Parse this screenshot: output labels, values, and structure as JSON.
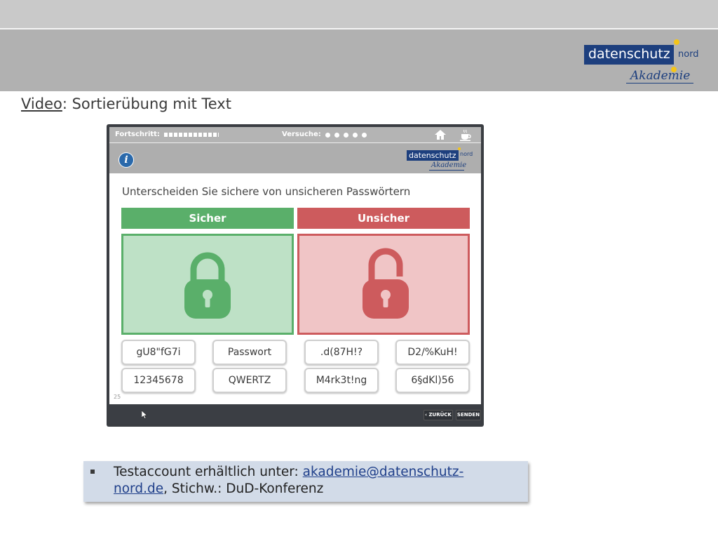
{
  "slide": {
    "title_keyword": "Video",
    "title_rest": ": Sortierübung mit Text"
  },
  "logo": {
    "brand": "datenschutz",
    "suffix": "nord",
    "subline": "Akademie"
  },
  "video": {
    "progress_label": "Fortschritt:",
    "progress_value": 1.0,
    "attempts_label": "Versuche:",
    "attempts_total": 5,
    "question": "Unterscheiden Sie sichere von unsicheren Passwörtern",
    "categories": [
      {
        "label": "Sicher",
        "color": "#5aaf6a"
      },
      {
        "label": "Unsicher",
        "color": "#cd5b5d"
      }
    ],
    "chips": [
      "gU8\"fG7i",
      "Passwort",
      ".d(87H!?",
      "D2/%KuH!",
      "12345678",
      "QWERTZ",
      "M4rk3t!ng",
      "6§dKl)56"
    ],
    "page_number": "25",
    "back_label": "‹ ZURÜCK",
    "send_label": "SENDEN",
    "icons": [
      "info-icon",
      "home-icon",
      "coffee-icon",
      "lock-closed-icon",
      "lock-open-icon"
    ]
  },
  "note": {
    "text_before": "Testaccount erhältlich unter: ",
    "link_part1": "akademie@datenschutz-",
    "link_part2": "nord.de",
    "text_after": ", Stichw.: DuD-Konferenz"
  },
  "colors": {
    "header_band": "#b1b1b1",
    "sicher": "#5aaf6a",
    "unsicher": "#cd5b5d",
    "logo_blue": "#1d3f7e",
    "note_bg": "#d2dbe8"
  }
}
